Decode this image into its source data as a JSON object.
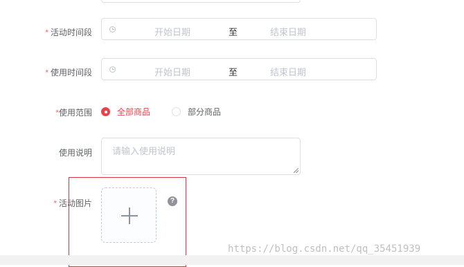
{
  "form": {
    "activity_time": {
      "required_mark": "*",
      "label": "活动时间段",
      "start_placeholder": "开始日期",
      "separator": "至",
      "end_placeholder": "结束日期"
    },
    "use_time": {
      "required_mark": "*",
      "label": "使用时间段",
      "start_placeholder": "开始日期",
      "separator": "至",
      "end_placeholder": "结束日期"
    },
    "use_scope": {
      "required_mark": "*",
      "label": "使用范围",
      "options": [
        {
          "label": "全部商品",
          "checked": true
        },
        {
          "label": "部分商品",
          "checked": false
        }
      ]
    },
    "use_description": {
      "label": "使用说明",
      "placeholder": "请输入使用说明"
    },
    "activity_image": {
      "required_mark": "*",
      "label": "活动图片",
      "help_icon": "?"
    }
  },
  "watermark": "https://blog.csdn.net/qq_35451939",
  "colors": {
    "required": "#f56c6c",
    "radio_active": "#e8424a",
    "highlight_box": "#d9363e",
    "border": "#dcdfe6",
    "placeholder": "#c0c4cc"
  },
  "icons": {
    "date_range": "clock-icon",
    "uploader": "plus-icon",
    "help": "question-circle-icon"
  }
}
